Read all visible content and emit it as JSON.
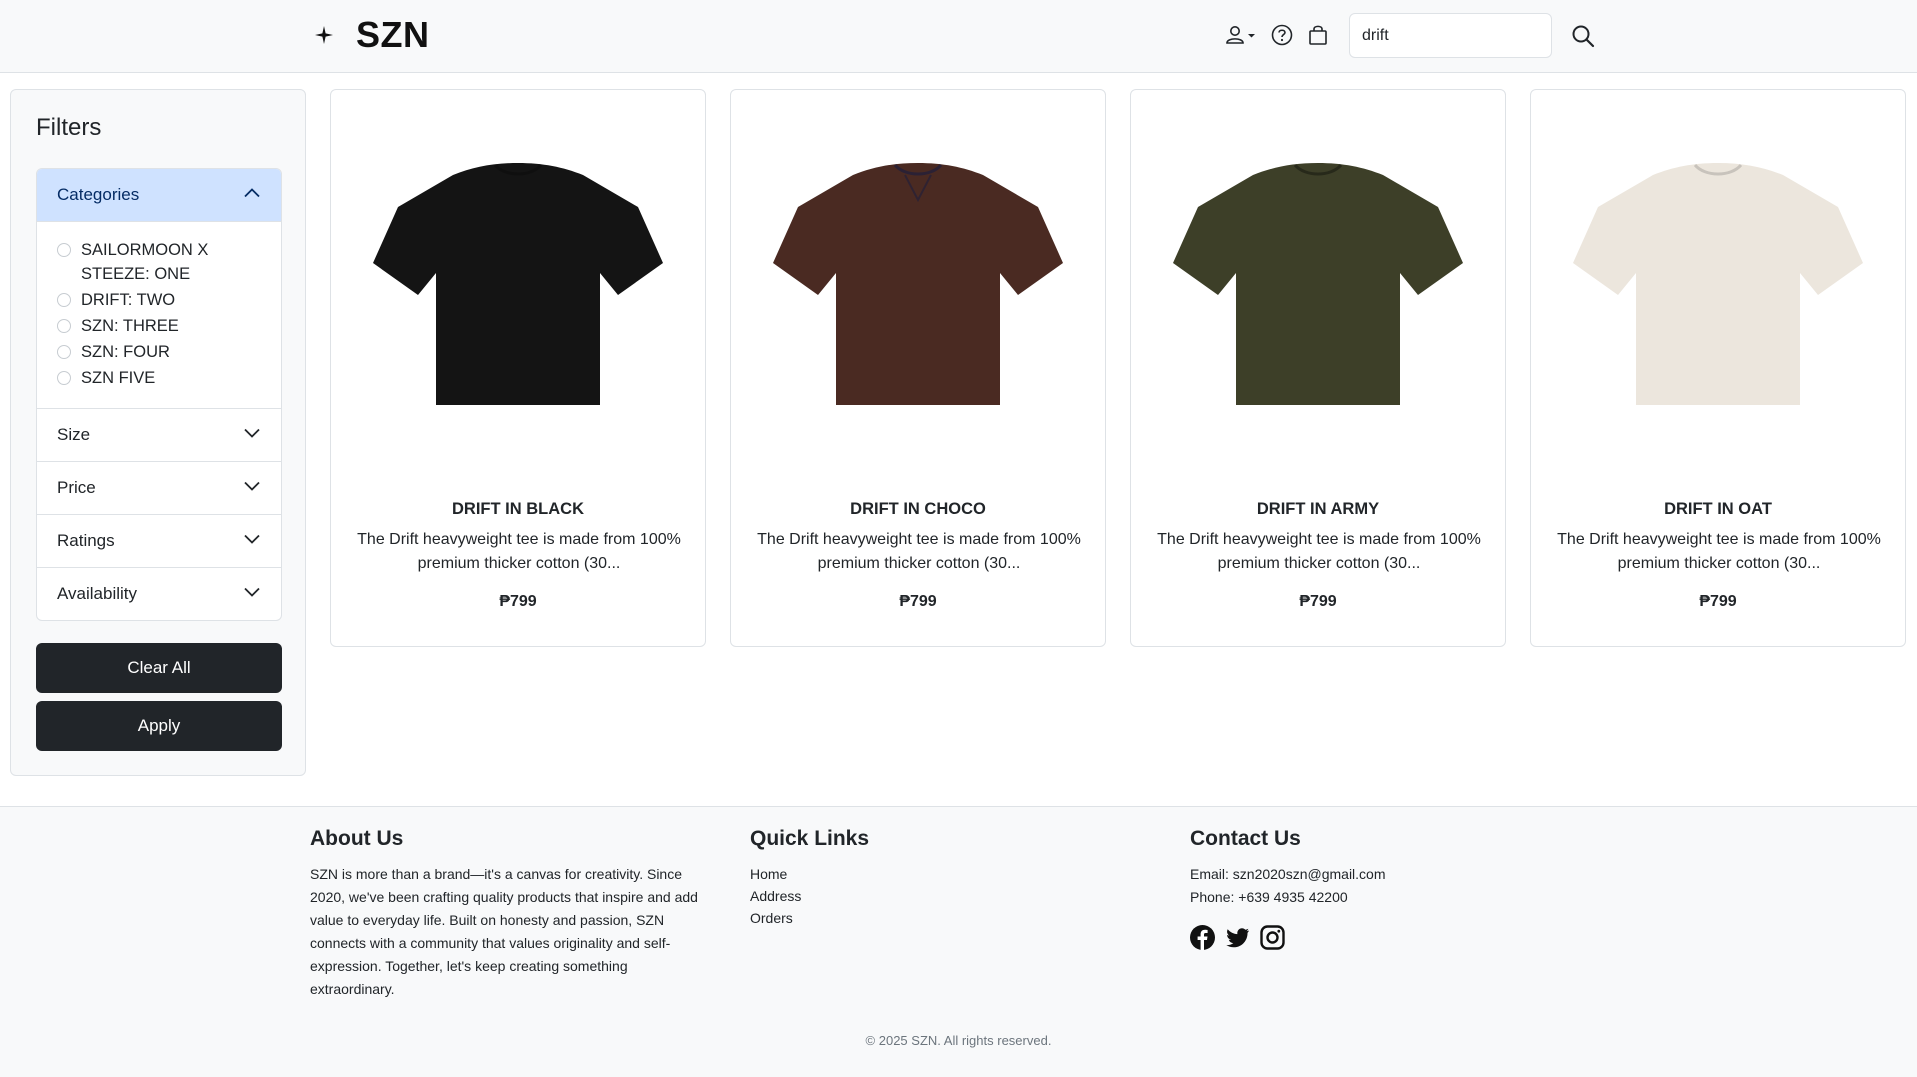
{
  "header": {
    "brand": "SZN",
    "search_value": "drift"
  },
  "sidebar": {
    "title": "Filters",
    "categories_label": "Categories",
    "categories": [
      {
        "line1": "SAILORMOON X",
        "line2": "STEEZE: ONE"
      },
      {
        "line1": "DRIFT: TWO",
        "line2": ""
      },
      {
        "line1": "SZN: THREE",
        "line2": ""
      },
      {
        "line1": "SZN: FOUR",
        "line2": ""
      },
      {
        "line1": "SZN FIVE",
        "line2": ""
      }
    ],
    "sections": [
      "Size",
      "Price",
      "Ratings",
      "Availability"
    ],
    "clear_label": "Clear All",
    "apply_label": "Apply"
  },
  "products": [
    {
      "name": "DRIFT IN BLACK",
      "desc_line1": "The Drift heavyweight tee is made from 100%",
      "desc_line2": "premium thicker cotton (30...",
      "price": "₱799",
      "color": "#141414"
    },
    {
      "name": "DRIFT IN CHOCO",
      "desc_line1": "The Drift heavyweight tee is made from 100%",
      "desc_line2": "premium thicker cotton (30...",
      "price": "₱799",
      "color": "#4a2a22"
    },
    {
      "name": "DRIFT IN ARMY",
      "desc_line1": "The Drift heavyweight tee is made from 100%",
      "desc_line2": "premium thicker cotton (30...",
      "price": "₱799",
      "color": "#3d3f28"
    },
    {
      "name": "DRIFT IN OAT",
      "desc_line1": "The Drift heavyweight tee is made from 100%",
      "desc_line2": "premium thicker cotton (30...",
      "price": "₱799",
      "color": "#ece6dd"
    }
  ],
  "footer": {
    "about_title": "About Us",
    "about_lines": [
      "SZN is more than a brand—it's a canvas for creativity. Since",
      "2020, we've been crafting quality products that inspire and add",
      "value to everyday life. Built on honesty and passion, SZN",
      "connects with a community that values originality and self-",
      "expression. Together, let's keep creating something",
      "extraordinary."
    ],
    "links_title": "Quick Links",
    "links": [
      "Home",
      "Address",
      "Orders"
    ],
    "contact_title": "Contact Us",
    "email": "Email: szn2020szn@gmail.com",
    "phone": "Phone: +639 4935 42200",
    "social": [
      "facebook-icon",
      "twitter-icon",
      "instagram-icon"
    ],
    "copyright": "© 2025 SZN. All rights reserved."
  }
}
